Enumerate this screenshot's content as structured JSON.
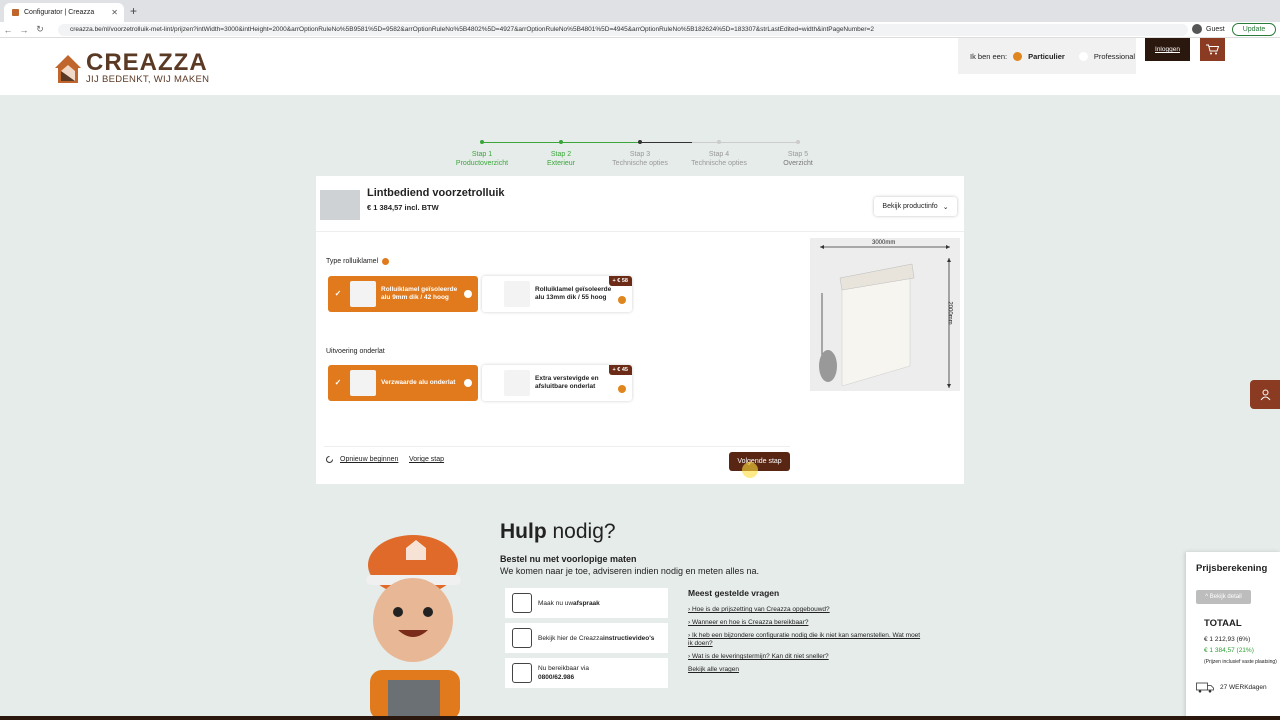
{
  "browser": {
    "tab_title": "Configurator | Creazza",
    "url": "creazza.be/nl/voorzetrolluik-met-lint/prijzen?intWidth=3000&intHeight=2000&arrOptionRuleNo%5B9581%5D=9582&arrOptionRuleNo%5B4802%5D=4927&arrOptionRuleNo%5B4801%5D=4945&arrOptionRuleNo%5B182624%5D=183307&strLastEdited=width&intPageNumber=2",
    "profile_label": "Guest",
    "update_label": "Update"
  },
  "header": {
    "logo_name": "CREAZZA",
    "logo_tagline": "JIJ BEDENKT, WIJ MAKEN",
    "user_type_label": "Ik ben een:",
    "user_type_selected": "Particulier",
    "user_type_other": "Professional",
    "login_label": "Inloggen"
  },
  "steps": [
    {
      "name": "Stap 1",
      "label": "Productoverzicht",
      "state": "done"
    },
    {
      "name": "Stap 2",
      "label": "Exterieur",
      "state": "done"
    },
    {
      "name": "Stap 3",
      "label": "Technische opties",
      "state": "current"
    },
    {
      "name": "Stap 4",
      "label": "Technische opties",
      "state": "todo"
    },
    {
      "name": "Stap 5",
      "label": "Overzicht",
      "state": "todo"
    }
  ],
  "product": {
    "title": "Lintbediend voorzetrolluik",
    "price": "€ 1 384,57 incl. BTW",
    "info_button": "Bekijk productinfo"
  },
  "sections": {
    "slat_type": {
      "label": "Type rolluiklamel",
      "options": [
        {
          "text": "Rolluiklamel geïsoleerde alu 9mm dik / 42 hoog",
          "selected": true,
          "price_tag": ""
        },
        {
          "text": "Rolluiklamel geïsoleerde alu 13mm dik / 55 hoog",
          "selected": false,
          "price_tag": "+ € 58"
        }
      ]
    },
    "bottom_rail": {
      "label": "Uitvoering onderlat",
      "options": [
        {
          "text": "Verzwaarde alu onderlat",
          "selected": true,
          "price_tag": ""
        },
        {
          "text": "Extra verstevigde en afsluitbare onderlat",
          "selected": false,
          "price_tag": "+ € 45"
        }
      ]
    }
  },
  "drawing": {
    "width_label": "3000mm",
    "height_label": "2000mm"
  },
  "actions": {
    "restart": "Opnieuw beginnen",
    "previous": "Vorige stap",
    "next": "Volgende stap"
  },
  "help": {
    "title_bold": "Hulp",
    "title_rest": " nodig?",
    "subtitle": "Bestel nu met voorlopige maten",
    "subtitle2": "We komen naar je toe, adviseren indien nodig en meten alles na.",
    "boxes": [
      {
        "prefix": "Maak nu uw ",
        "bold": "afspraak"
      },
      {
        "prefix": "Bekijk hier de Creazza ",
        "bold": "instructievideo's"
      },
      {
        "prefix": "Nu bereikbaar via",
        "bold": "0800/62.986"
      }
    ],
    "faq_title": "Meest gestelde vragen",
    "faqs": [
      "Hoe is de prijszetting van Creazza opgebouwd?",
      "Wanneer en hoe is Creazza bereikbaar?",
      "Ik heb een bijzondere configuratie nodig die ik niet kan samenstellen. Wat moet ik doen?",
      "Wat is de leveringstermijn? Kan dit niet sneller?"
    ],
    "faq_all": "Bekijk alle vragen"
  },
  "price_panel": {
    "title": "Prijsberekening",
    "detail_button": "^ Bekijk detail",
    "total_label": "TOTAAL",
    "price_excl": "€ 1 212,93 (6%)",
    "price_incl": "€ 1 384,57 (21%)",
    "note": "(Prijzen inclusief vaste plaatsing)",
    "delivery": "27 WERKdagen"
  },
  "colors": {
    "accent_orange": "#e07a1c",
    "dark_brown": "#5a2614",
    "step_green": "#3aa63a"
  }
}
